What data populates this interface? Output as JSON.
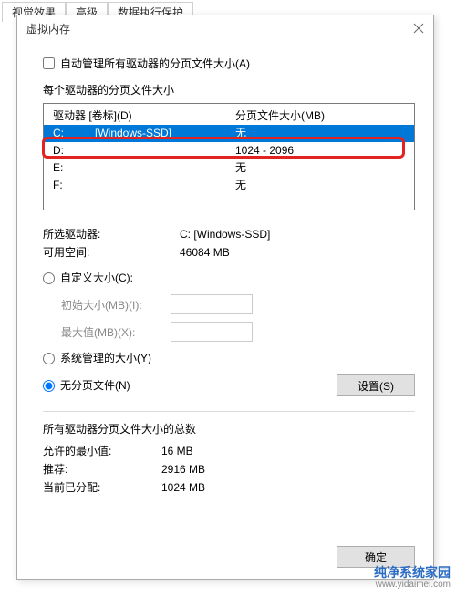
{
  "bg_tabs": {
    "t0": "视觉效果",
    "t1": "高级",
    "t2": "数据执行保护"
  },
  "dialog": {
    "title": "虚拟内存",
    "auto_label": "自动管理所有驱动器的分页文件大小(A)",
    "per_drive_label": "每个驱动器的分页文件大小",
    "hdr_drive": "驱动器 [卷标](D)",
    "hdr_pf": "分页文件大小(MB)",
    "drives": [
      {
        "letter": "C:",
        "label": "[Windows-SSD]",
        "pf": "无",
        "selected": true
      },
      {
        "letter": "D:",
        "label": "",
        "pf": "1024 - 2096",
        "selected": false
      },
      {
        "letter": "E:",
        "label": "",
        "pf": "无",
        "selected": false
      },
      {
        "letter": "F:",
        "label": "",
        "pf": "无",
        "selected": false
      }
    ],
    "sel_drive_label": "所选驱动器:",
    "sel_drive_val": "C:  [Windows-SSD]",
    "free_label": "可用空间:",
    "free_val": "46084 MB",
    "radio_custom": "自定义大小(C):",
    "init_label": "初始大小(MB)(I):",
    "max_label": "最大值(MB)(X):",
    "radio_sys": "系统管理的大小(Y)",
    "radio_none": "无分页文件(N)",
    "set_btn": "设置(S)",
    "totals_label": "所有驱动器分页文件大小的总数",
    "min_label": "允许的最小值:",
    "min_val": "16 MB",
    "rec_label": "推荐:",
    "rec_val": "2916 MB",
    "cur_label": "当前已分配:",
    "cur_val": "1024 MB",
    "ok_btn": "确定"
  },
  "watermark": {
    "l1": "纯净系统家园",
    "l2": "www.yidaimei.com"
  }
}
